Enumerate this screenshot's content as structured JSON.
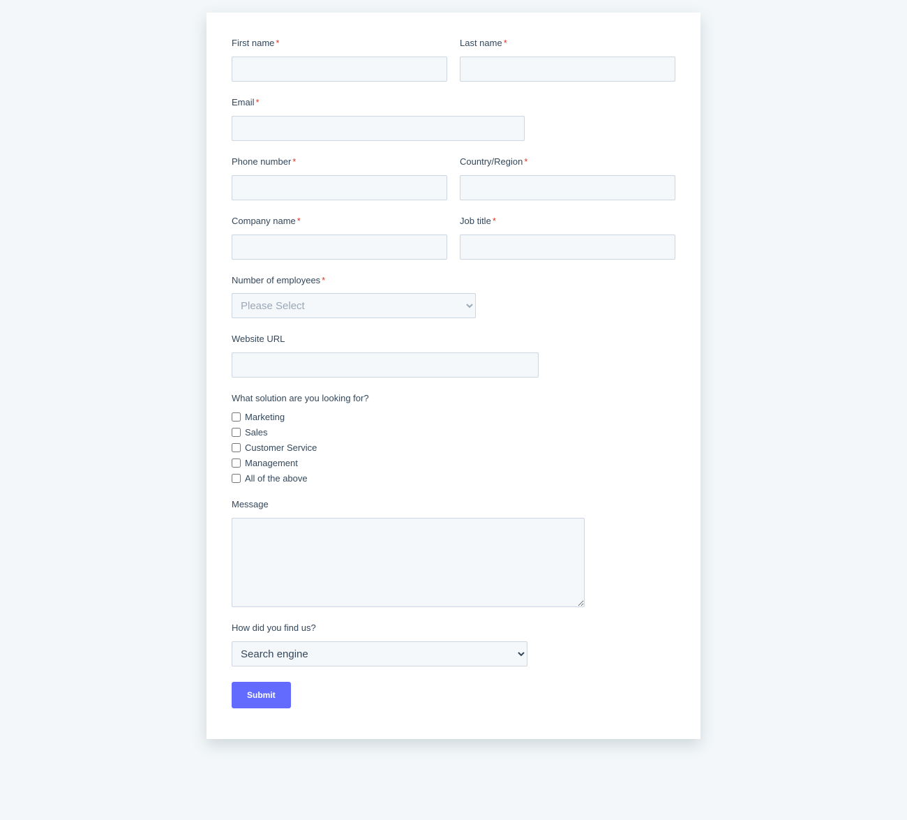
{
  "form": {
    "first_name": {
      "label": "First name",
      "required": true,
      "value": ""
    },
    "last_name": {
      "label": "Last name",
      "required": true,
      "value": ""
    },
    "email": {
      "label": "Email",
      "required": true,
      "value": ""
    },
    "phone": {
      "label": "Phone number",
      "required": true,
      "value": ""
    },
    "country": {
      "label": "Country/Region",
      "required": true,
      "value": ""
    },
    "company": {
      "label": "Company name",
      "required": true,
      "value": ""
    },
    "job_title": {
      "label": "Job title",
      "required": true,
      "value": ""
    },
    "employees": {
      "label": "Number of employees",
      "required": true,
      "selected": "Please Select",
      "placeholder": "Please Select"
    },
    "website": {
      "label": "Website URL",
      "required": false,
      "value": ""
    },
    "solution": {
      "label": "What solution are you looking for?",
      "options": [
        {
          "label": "Marketing",
          "checked": false
        },
        {
          "label": "Sales",
          "checked": false
        },
        {
          "label": "Customer Service",
          "checked": false
        },
        {
          "label": "Management",
          "checked": false
        },
        {
          "label": "All of the above",
          "checked": false
        }
      ]
    },
    "message": {
      "label": "Message",
      "value": ""
    },
    "source": {
      "label": "How did you find us?",
      "selected": "Search engine"
    },
    "submit_label": "Submit"
  }
}
